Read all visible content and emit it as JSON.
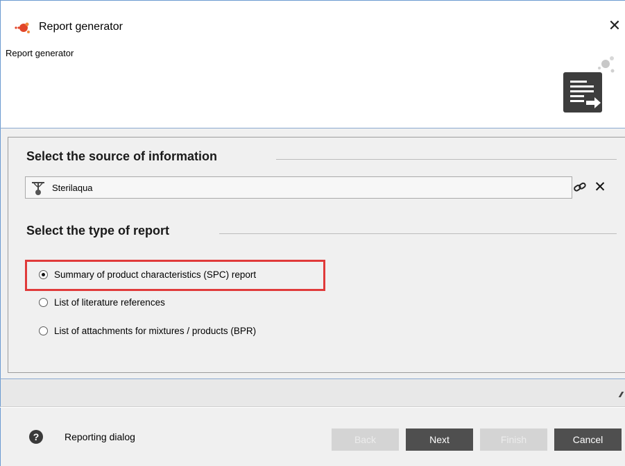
{
  "window": {
    "title": "Report generator",
    "close_symbol": "✕"
  },
  "header": {
    "subtitle": "Report generator",
    "icon": "report-generator-icon"
  },
  "source_section": {
    "title": "Select the source of information",
    "selected_value": "Sterilaqua",
    "source_icon": "substance-icon",
    "link_symbol": "🔗",
    "clear_symbol": "✕"
  },
  "report_type_section": {
    "title": "Select the type of report",
    "options": [
      {
        "label": "Summary of product characteristics (SPC) report",
        "checked": true
      },
      {
        "label": "List of literature references",
        "checked": false
      },
      {
        "label": "List of attachments for mixtures / products (BPR)",
        "checked": false
      }
    ]
  },
  "footer": {
    "help_symbol": "?",
    "help_text": "Reporting dialog",
    "buttons": {
      "back": "Back",
      "next": "Next",
      "finish": "Finish",
      "cancel": "Cancel"
    }
  },
  "colors": {
    "highlight": "#e03a3a",
    "button_enabled": "#4f4f4f",
    "button_disabled": "#d4d4d4",
    "window_border": "#6b9ad1"
  }
}
